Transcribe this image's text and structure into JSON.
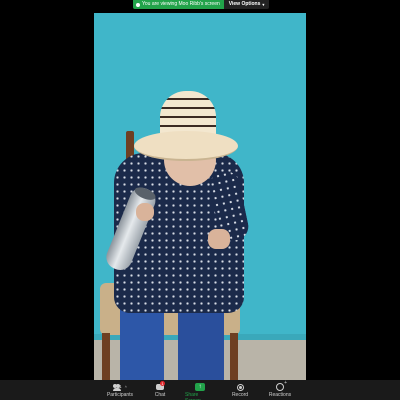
{
  "share_banner": {
    "notice": "You are viewing Moo Ribb's screen",
    "view_options": "View Options"
  },
  "toolbar": {
    "participants_count": "41",
    "participants_label": "Participants",
    "chat_label": "Chat",
    "chat_badge": "1",
    "share_label": "Share Screen",
    "record_label": "Record",
    "reactions_label": "Reactions"
  },
  "colors": {
    "share_green": "#22a34a",
    "toolbar_bg": "#1a1a1a",
    "badge_red": "#e0262b",
    "video_wall": "#40b6c9"
  },
  "icons": {
    "participants": "people-icon",
    "chat": "chat-icon",
    "share": "share-screen-icon",
    "record": "record-icon",
    "reactions": "reactions-icon"
  }
}
